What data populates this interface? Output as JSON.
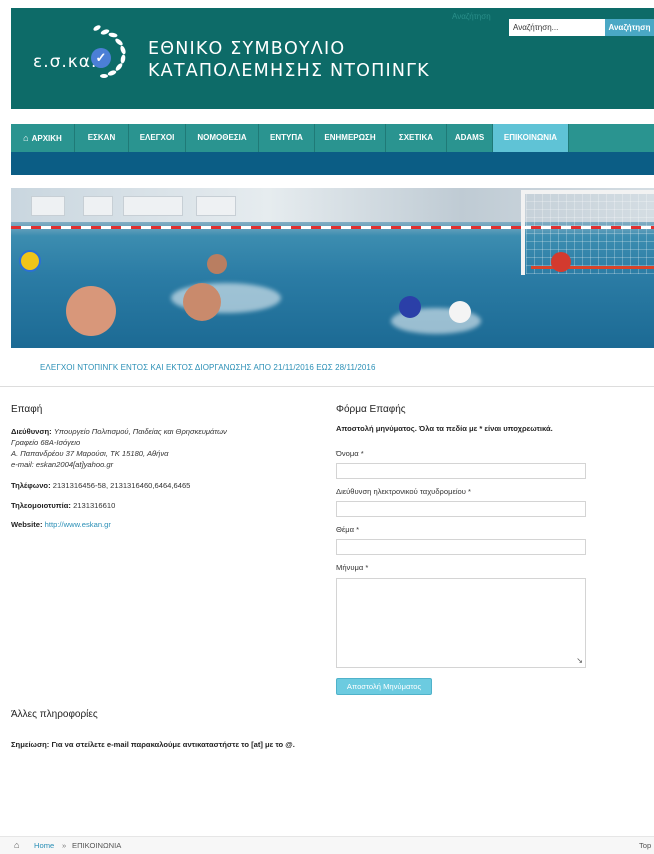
{
  "header": {
    "logo_text": "ε.σ.κα.",
    "title_line1": "ΕΘΝΙΚΟ ΣΥΜΒΟΥΛΙΟ",
    "title_line2": "ΚΑΤΑΠΟΛΕΜΗΣΗΣ ΝΤΟΠΙΝΓΚ",
    "search_label": "Αναζήτηση",
    "search_placeholder": "Αναζήτηση...",
    "search_button": "Αναζήτηση"
  },
  "nav": {
    "items": [
      {
        "label": "ΑΡΧΙΚΗ",
        "icon": "home-icon"
      },
      {
        "label": "ΕΣΚΑΝ"
      },
      {
        "label": "ΕΛΕΓΧΟΙ"
      },
      {
        "label": "ΝΟΜΟΘΕΣΙΑ"
      },
      {
        "label": "ΕΝΤΥΠΑ"
      },
      {
        "label": "ΕΝΗΜΕΡΩΣΗ"
      },
      {
        "label": "ΣΧΕΤΙΚΑ"
      },
      {
        "label": "ADAMS"
      },
      {
        "label": "ΕΠΙΚΟΙΝΩΝΙΑ",
        "active": true
      }
    ]
  },
  "announcement": "ΕΛΕΓΧΟΙ ΝΤΟΠΙΝΓΚ ΕΝΤΟΣ ΚΑΙ ΕΚΤΟΣ ΔΙΟΡΓΑΝΩΣΗΣ ΑΠΟ 21/11/2016 ΕΩΣ 28/11/2016",
  "contact": {
    "heading": "Επαφή",
    "address_label": "Διεύθυνση:",
    "address_line1": "Υπουργείο Πολιτισμού, Παιδείας και Θρησκευμάτων",
    "address_line2": "Γραφείο 68Α-Ισόγειο",
    "address_line3": "Α. Παπανδρέου 37 Μαρούσι, ΤΚ 15180, Αθήνα",
    "address_line4": "e-mail: eskan2004[at]yahoo.gr",
    "phone_label": "Τηλέφωνο:",
    "phone_value": "2131316456-58, 2131316460,6464,6465",
    "fax_label": "Τηλεομοιοτυπία:",
    "fax_value": "2131316610",
    "website_label": "Website:",
    "website_value": "http://www.eskan.gr"
  },
  "form": {
    "heading": "Φόρμα Επαφής",
    "intro": "Αποστολή μηνύματος. Όλα τα πεδία με * είναι υποχρεωτικά.",
    "name_label": "Όνομα *",
    "email_label": "Διεύθυνση ηλεκτρονικού ταχυδρομείου *",
    "subject_label": "Θέμα *",
    "message_label": "Μήνυμα *",
    "submit_label": "Αποστολή Μηνύματος"
  },
  "other": {
    "heading": "Άλλες πληροφορίες",
    "note": "Σημείωση: Για να στείλετε e-mail παρακαλούμε αντικαταστήστε το [at] με το @."
  },
  "breadcrumb": {
    "home": "Home",
    "separator": "»",
    "current": "ΕΠΙΚΟΙΝΩΝΙΑ",
    "top": "Top"
  },
  "colors": {
    "header_bg": "#0d6b68",
    "nav_bg": "#2a9490",
    "nav_active": "#5fc3d6",
    "subbar": "#0b5d85",
    "link": "#2a8fb6"
  }
}
